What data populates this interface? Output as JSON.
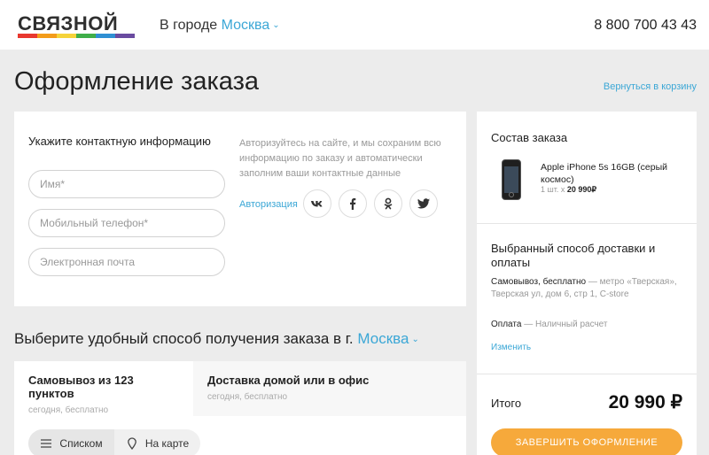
{
  "header": {
    "logo_text": "СВЯЗНОЙ",
    "logo_stripe_colors": [
      "#e8382f",
      "#f39c1a",
      "#f5d33a",
      "#3fae49",
      "#2f8fd3",
      "#6a4ba0"
    ],
    "city_prefix": "В городе",
    "city": "Москва",
    "phone": "8 800 700 43 43"
  },
  "page": {
    "title": "Оформление заказа",
    "back_link": "Вернуться в корзину"
  },
  "contact": {
    "title": "Укажите контактную информацию",
    "name_placeholder": "Имя*",
    "phone_placeholder": "Мобильный телефон*",
    "email_placeholder": "Электронная почта",
    "auth_note": "Авторизуйтесь на сайте, и мы сохраним всю информацию по заказу и автоматически заполним ваши контактные данные",
    "auth_link": "Авторизация",
    "socials": [
      "vk-icon",
      "facebook-icon",
      "odnoklassniki-icon",
      "twitter-icon"
    ]
  },
  "delivery": {
    "title_prefix": "Выберите удобный способ получения заказа в г.",
    "city": "Москва",
    "tabs": [
      {
        "title": "Самовывоз из 123 пунктов",
        "sub": "сегодня, бесплатно"
      },
      {
        "title": "Доставка домой или в офис",
        "sub": "сегодня, бесплатно"
      }
    ],
    "view_list": "Списком",
    "view_map": "На карте"
  },
  "order": {
    "title": "Состав заказа",
    "product_name": "Apple iPhone 5s 16GB (серый космос)",
    "product_qty_prefix": "1 шт. x",
    "product_price": "20 990₽",
    "delivery_heading": "Выбранный способ доставки и оплаты",
    "pickup_label": "Самовывоз, бесплатно",
    "pickup_detail": "— метро «Тверская», Тверская ул, дом 6, стр 1, C-store",
    "payment_label": "Оплата",
    "payment_detail": "— Наличный расчет",
    "change_link": "Изменить",
    "total_label": "Итого",
    "total_value": "20 990 ₽",
    "submit_label": "ЗАВЕРШИТЬ ОФОРМЛЕНИЕ"
  },
  "colors": {
    "accent_link": "#3ba7d6",
    "submit_button": "#f6a93b",
    "page_background": "#ececec"
  }
}
